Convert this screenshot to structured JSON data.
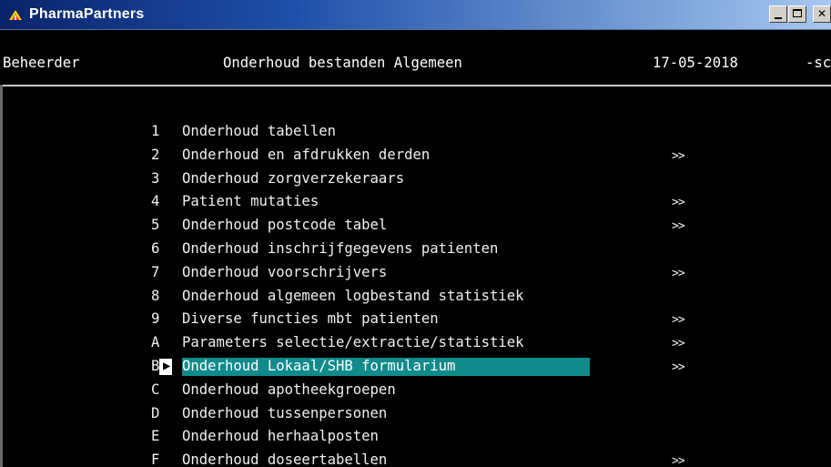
{
  "window": {
    "title": "PharmaPartners",
    "minimize_label": "_",
    "close_label": "✕"
  },
  "status_bar": {
    "user": "Beheerder",
    "screen_title": "Onderhoud bestanden Algemeen",
    "date": "17-05-2018",
    "right_fragment": "-sc"
  },
  "menu": {
    "items": [
      {
        "key": "1",
        "label": "Onderhoud tabellen",
        "arrow": ""
      },
      {
        "key": "2",
        "label": "Onderhoud en afdrukken derden",
        "arrow": ">>"
      },
      {
        "key": "3",
        "label": "Onderhoud zorgverzekeraars",
        "arrow": ""
      },
      {
        "key": "4",
        "label": "Patient mutaties",
        "arrow": ">>"
      },
      {
        "key": "5",
        "label": "Onderhoud postcode tabel",
        "arrow": ">>"
      },
      {
        "key": "6",
        "label": "Onderhoud inschrijfgegevens patienten",
        "arrow": ""
      },
      {
        "key": "7",
        "label": "Onderhoud voorschrijvers",
        "arrow": ">>"
      },
      {
        "key": "8",
        "label": "Onderhoud algemeen logbestand statistiek",
        "arrow": ""
      },
      {
        "key": "9",
        "label": "Diverse functies mbt patienten",
        "arrow": ">>"
      },
      {
        "key": "A",
        "label": "Parameters selectie/extractie/statistiek",
        "arrow": ">>"
      },
      {
        "key": "B",
        "label": "Onderhoud Lokaal/SHB formularium",
        "arrow": ">>"
      },
      {
        "key": "C",
        "label": "Onderhoud apotheekgroepen",
        "arrow": ""
      },
      {
        "key": "D",
        "label": "Onderhoud tussenpersonen",
        "arrow": ""
      },
      {
        "key": "E",
        "label": "Onderhoud herhaalposten",
        "arrow": ""
      },
      {
        "key": "F",
        "label": "Onderhoud doseertabellen",
        "arrow": ">>"
      }
    ],
    "selected_key": "B",
    "cursor_glyph": "▶"
  },
  "colors": {
    "title_bar_start": "#0a246a",
    "terminal_bg": "#000000",
    "terminal_fg": "#e8e8e8",
    "highlight_bg": "#108a8a"
  }
}
